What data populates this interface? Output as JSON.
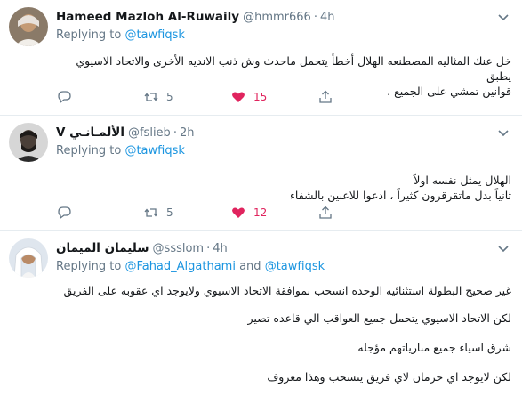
{
  "tweets": [
    {
      "name": "Hameed Mazloh Al-Ruwaily",
      "handle": "@hmmr666",
      "time": "4h",
      "replying_prefix": "Replying to",
      "reply_to": "@tawfiqsk",
      "reply_sep": "",
      "reply_to2": "",
      "lines": [
        "خل عنك المثاليه المصطنعه الهلال أخطأ يتحمل ماحدث وش ذنب الانديه الأخرى والاتحاد الاسيوي يطبق",
        "قوانين تمشي على الجميع ."
      ],
      "retweets": "5",
      "likes": "15",
      "liked": true
    },
    {
      "name": "V الألمـانـي",
      "handle": "@fslieb",
      "time": "2h",
      "replying_prefix": "Replying to",
      "reply_to": "@tawfiqsk",
      "reply_sep": "",
      "reply_to2": "",
      "lines": [
        "الهلال يمثل نفسه اولاً",
        "ثانياً بدل ماتقرقرون كثيراً ، ادعوا للاعبين بالشفاء"
      ],
      "retweets": "5",
      "likes": "12",
      "liked": true
    },
    {
      "name": "سليمان الميمان",
      "handle": "@ssslom",
      "time": "4h",
      "replying_prefix": "Replying to",
      "reply_to": "@Fahad_Algathami",
      "reply_sep": "and",
      "reply_to2": "@tawfiqsk",
      "lines": [
        "غير صحيح البطولة استثنائيه الوحده انسحب بموافقة الاتحاد الاسيوي ولايوجد اي عقوبه على الفريق",
        "لكن الاتحاد الاسيوي يتحمل جميع العواقب الي قاعده تصير",
        "شرق اسياء جميع مبارياتهم مؤجله",
        "لكن لايوجد اي حرمان لاي فريق ينسحب وهذا معروف"
      ],
      "retweets": "",
      "likes": "",
      "liked": false
    }
  ],
  "icons": [
    "reply-icon",
    "retweet-icon",
    "like-icon",
    "share-icon",
    "chevron-down-icon"
  ],
  "colors": {
    "link": "#1b95e0",
    "like": "#e0245e",
    "muted": "#657786"
  }
}
